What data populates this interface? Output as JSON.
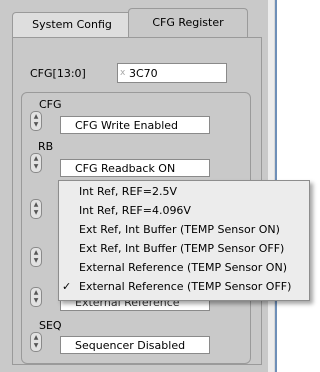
{
  "tabs": [
    {
      "label": "System Config"
    },
    {
      "label": "CFG Register"
    }
  ],
  "cfg_register": {
    "label": "CFG[13:0]",
    "prefix": "x",
    "value": "3C70"
  },
  "fields": [
    {
      "label": "CFG",
      "value": "CFG Write Enabled"
    },
    {
      "label": "RB",
      "value": "CFG Readback ON"
    },
    {
      "label": "SEQ",
      "value": "Sequencer Disabled"
    }
  ],
  "menu": {
    "items": [
      {
        "label": "Int Ref, REF=2.5V",
        "check": ""
      },
      {
        "label": "Int Ref, REF=4.096V",
        "check": ""
      },
      {
        "label": "Ext Ref, Int Buffer (TEMP Sensor ON)",
        "check": ""
      },
      {
        "label": "Ext Ref, Int Buffer (TEMP Sensor OFF)",
        "check": ""
      },
      {
        "label": "External Reference (TEMP Sensor ON)",
        "check": ""
      },
      {
        "label": "External Reference (TEMP Sensor OFF)",
        "check": "✓"
      }
    ],
    "hidden_field_text": "External Reference"
  },
  "icons": {
    "spin_up": "▲",
    "spin_down": "▼"
  },
  "colors": {
    "window_bg": "#c9c9c9",
    "menu_bg": "#ececec",
    "accent_line": "#6e8fb8"
  }
}
